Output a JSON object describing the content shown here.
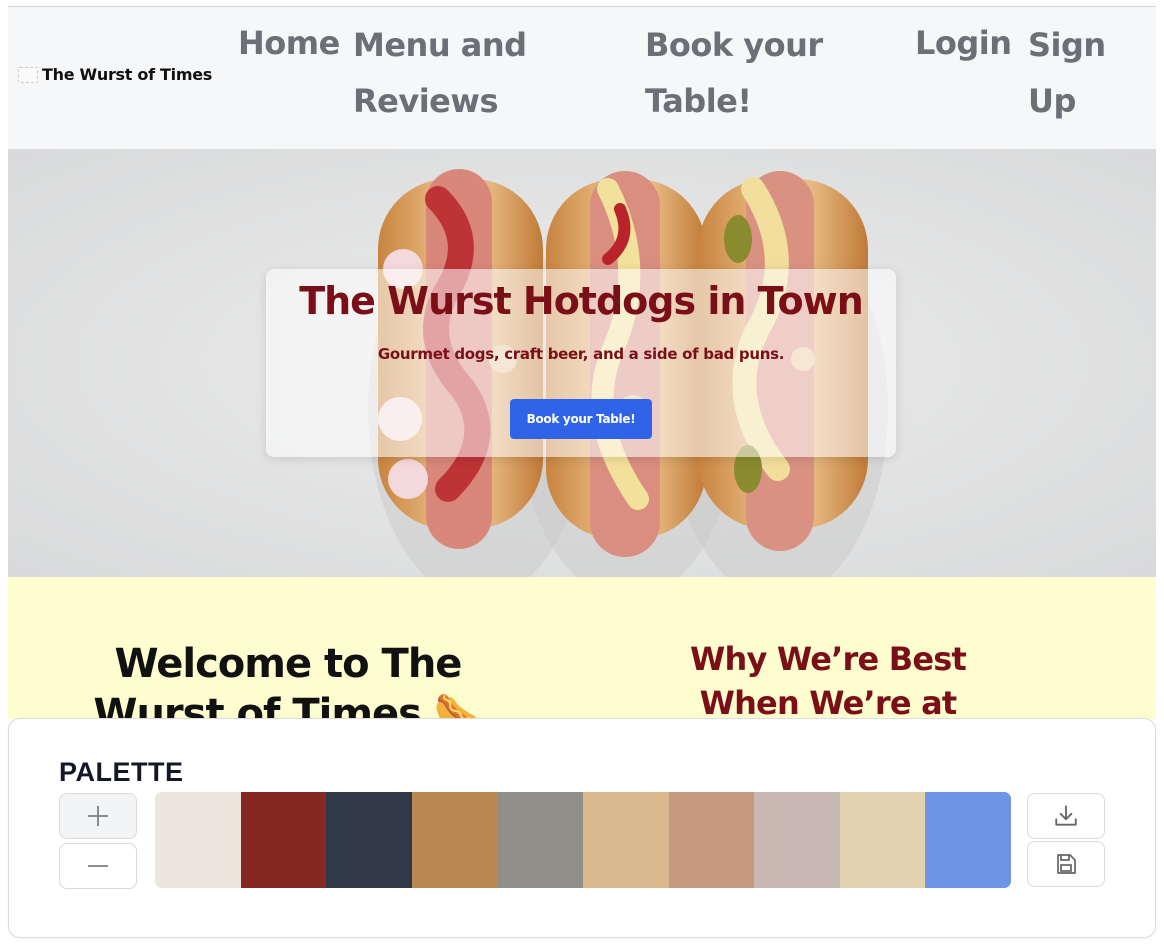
{
  "site": {
    "brand": "The Wurst of Times",
    "nav": {
      "home": "Home",
      "menu_line1": "Menu and",
      "menu_line2": "Reviews",
      "book_line1": "Book your",
      "book_line2": "Table!",
      "login": "Login",
      "signup_line1": "Sign",
      "signup_line2": "Up"
    },
    "hero": {
      "title": "The Wurst Hotdogs in Town",
      "subtitle": "Gourmet dogs, craft beer, and a side of bad puns.",
      "cta": "Book your Table!"
    },
    "welcome": {
      "line1": "Welcome to The",
      "line2": "Wurst of Times 🌭"
    },
    "why": {
      "line1": "Why We’re Best",
      "line2": "When We’re at"
    }
  },
  "palette": {
    "label": "PALETTE",
    "add_icon": "plus-icon",
    "remove_icon": "minus-icon",
    "download_icon": "download-icon",
    "save_icon": "save-icon",
    "colors": [
      "#ebe7df",
      "#85281f",
      "#313847",
      "#bb8753",
      "#8f8e88",
      "#d9b88d",
      "#c69a7e",
      "#c8b8b4",
      "#e2d2b0",
      "#6d94e5"
    ]
  }
}
